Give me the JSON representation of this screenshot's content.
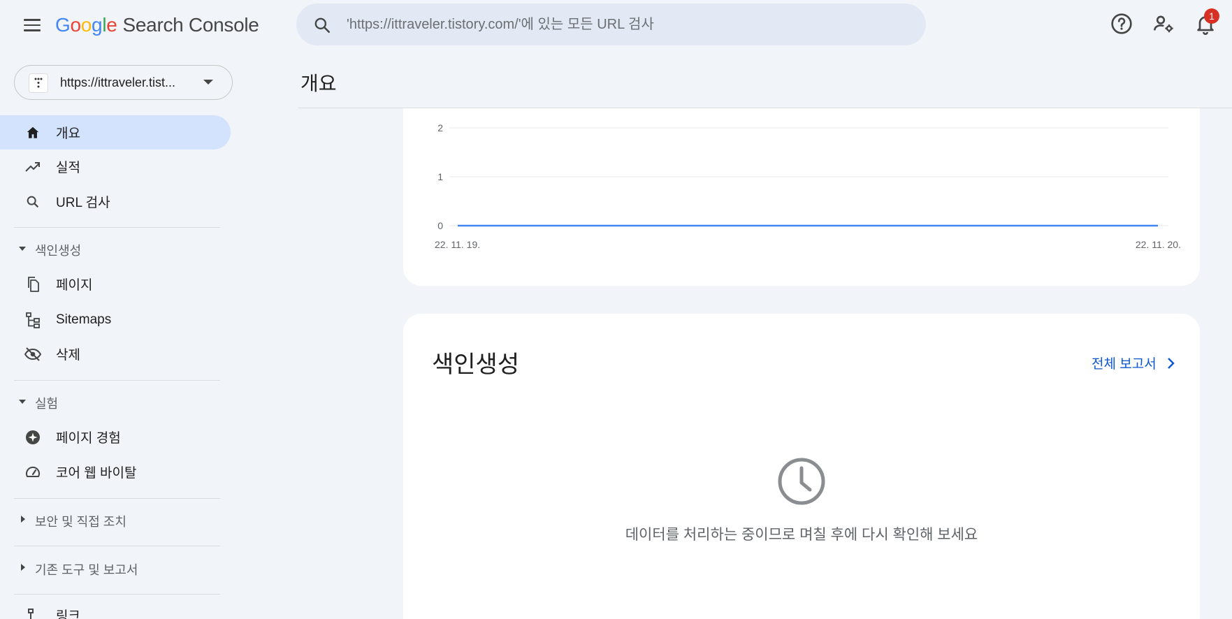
{
  "header": {
    "logo_letters": [
      "G",
      "o",
      "o",
      "g",
      "l",
      "e"
    ],
    "logo_product": "Search Console",
    "search_placeholder": "'https://ittraveler.tistory.com/'에 있는 모든 URL 검사",
    "icons": [
      "menu-icon",
      "search-icon",
      "help-icon",
      "manage-users-icon",
      "notifications-icon"
    ],
    "notification_count": "1"
  },
  "property": {
    "label": "https://ittraveler.tist..."
  },
  "sidebar": {
    "items": [
      {
        "label": "개요",
        "icon": "home-icon",
        "active": true
      },
      {
        "label": "실적",
        "icon": "trending-up-icon"
      },
      {
        "label": "URL 검사",
        "icon": "search-icon"
      }
    ],
    "sections": [
      {
        "label": "색인생성",
        "expanded": true,
        "items": [
          {
            "label": "페이지",
            "icon": "pages-icon"
          },
          {
            "label": "Sitemaps",
            "icon": "sitemap-icon"
          },
          {
            "label": "삭제",
            "icon": "eye-off-icon"
          }
        ]
      },
      {
        "label": "실험",
        "expanded": true,
        "items": [
          {
            "label": "페이지 경험",
            "icon": "plus-circle-icon"
          },
          {
            "label": "코어 웹 바이탈",
            "icon": "speedometer-icon"
          }
        ]
      },
      {
        "label": "보안 및 직접 조치",
        "expanded": false
      },
      {
        "label": "기존 도구 및 보고서",
        "expanded": false
      }
    ],
    "cut_off_item": "링크"
  },
  "main": {
    "page_title": "개요",
    "indexing_card": {
      "title": "색인생성",
      "report_link": "전체 보고서",
      "processing_message": "데이터를 처리하는 중이므로 며칠 후에 다시 확인해 보세요"
    }
  },
  "chart_data": {
    "type": "line",
    "x": [
      "22. 11. 19.",
      "22. 11. 20."
    ],
    "series": [
      {
        "values": [
          0,
          0
        ],
        "color": "#4285f4"
      }
    ],
    "yticks": [
      0,
      1,
      2
    ],
    "ylim": [
      0,
      2
    ],
    "grid": true
  }
}
